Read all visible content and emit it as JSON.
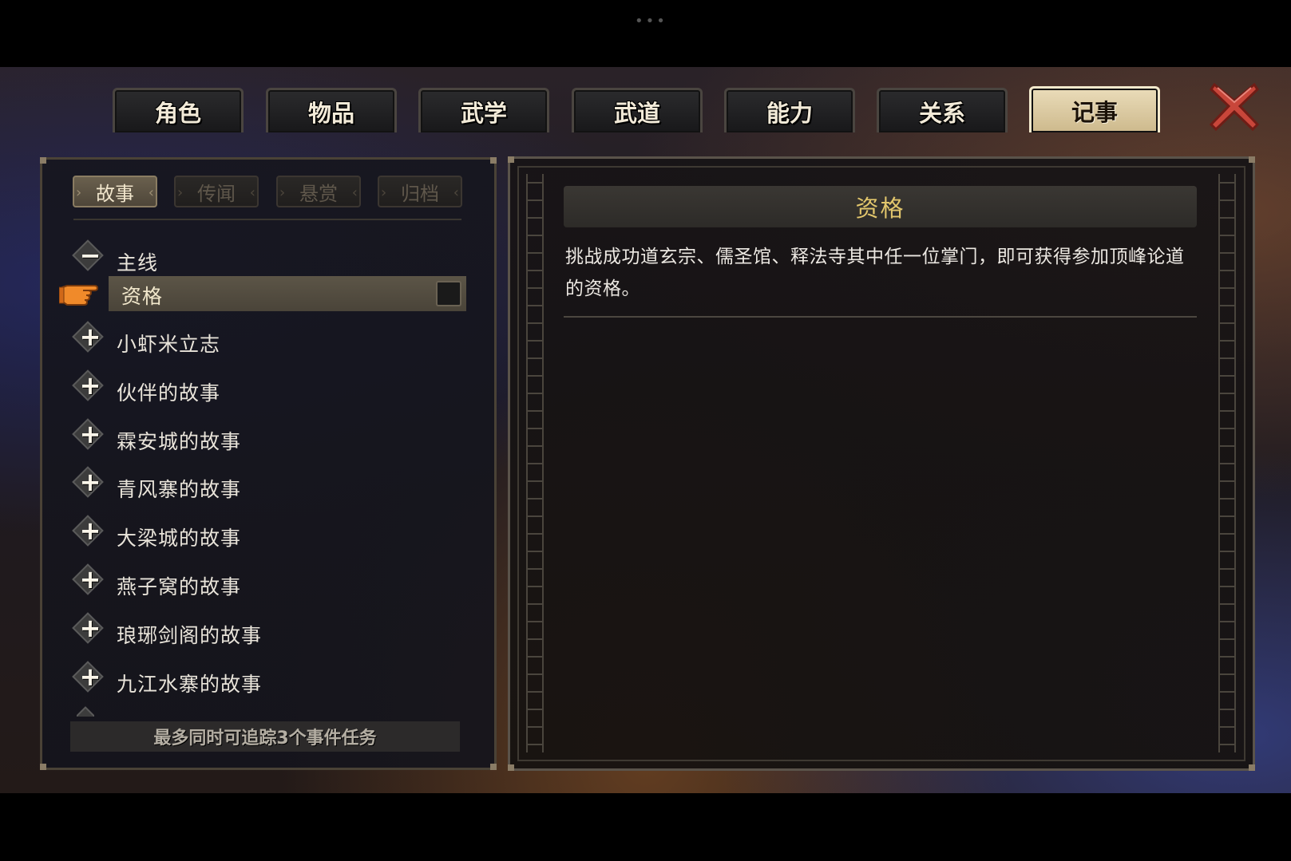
{
  "tabs": [
    {
      "label": "角色",
      "active": false
    },
    {
      "label": "物品",
      "active": false
    },
    {
      "label": "武学",
      "active": false
    },
    {
      "label": "武道",
      "active": false
    },
    {
      "label": "能力",
      "active": false
    },
    {
      "label": "关系",
      "active": false
    },
    {
      "label": "记事",
      "active": true
    }
  ],
  "subtabs": [
    {
      "label": "故事",
      "active": true
    },
    {
      "label": "传闻",
      "active": false
    },
    {
      "label": "悬赏",
      "active": false
    },
    {
      "label": "归档",
      "active": false
    }
  ],
  "tree": {
    "expanded_group": {
      "label": "主线",
      "sign": "−"
    },
    "selected_item": {
      "label": "资格",
      "tracked": false
    },
    "groups": [
      {
        "label": "小虾米立志",
        "sign": "+"
      },
      {
        "label": "伙伴的故事",
        "sign": "+"
      },
      {
        "label": "霖安城的故事",
        "sign": "+"
      },
      {
        "label": "青风寨的故事",
        "sign": "+"
      },
      {
        "label": "大梁城的故事",
        "sign": "+"
      },
      {
        "label": "燕子窝的故事",
        "sign": "+"
      },
      {
        "label": "琅琊剑阁的故事",
        "sign": "+"
      },
      {
        "label": "九江水寨的故事",
        "sign": "+"
      }
    ]
  },
  "track_note": "最多同时可追踪3个事件任务",
  "detail": {
    "title": "资格",
    "body": "挑战成功道玄宗、儒圣馆、释法寺其中任一位掌门，即可获得参加顶峰论道的资格。"
  },
  "colors": {
    "active_tab": "#e0d0a8",
    "title_gold": "#e2c66c",
    "close_red": "#c8463a"
  },
  "icons": {
    "close": "close-x-icon",
    "pointer": "pointing-hand-icon",
    "expand": "plus-icon",
    "collapse": "minus-icon"
  }
}
